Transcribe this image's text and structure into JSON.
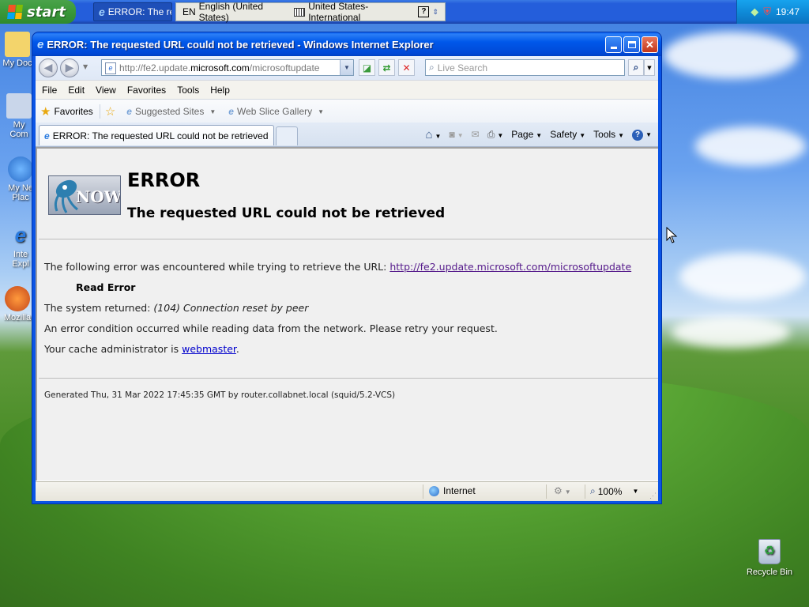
{
  "taskbar": {
    "start_label": "start",
    "task_ie_label": "ERROR: The re",
    "lang_code": "EN",
    "lang_name": "English (United States)",
    "keyboard_layout": "United States-International",
    "help_glyph": "?",
    "clock": "19:47"
  },
  "desktop": {
    "icons": [
      "My Doc",
      "My Com",
      "My Ne Plac",
      "Inte Expl",
      "Mozilla"
    ],
    "recycle_bin": "Recycle Bin"
  },
  "window": {
    "title": "ERROR: The requested URL could not be retrieved - Windows Internet Explorer",
    "address": {
      "prefix": "http://fe2.update.",
      "host": "microsoft.com",
      "path": "/microsoftupdate"
    },
    "search_placeholder": "Live Search",
    "menu": [
      "File",
      "Edit",
      "View",
      "Favorites",
      "Tools",
      "Help"
    ],
    "favorites_bar": {
      "favorites": "Favorites",
      "suggested": "Suggested Sites",
      "webslice": "Web Slice Gallery"
    },
    "tab_title": "ERROR: The requested URL could not be retrieved",
    "command_bar": {
      "page": "Page",
      "safety": "Safety",
      "tools": "Tools"
    },
    "status": {
      "zone": "Internet",
      "zoom": "100%"
    }
  },
  "page": {
    "logo_text": "NOW",
    "heading": "ERROR",
    "subheading": "The requested URL could not be retrieved",
    "line1_text": "The following error was encountered while trying to retrieve the URL: ",
    "line1_link": "http://fe2.update.microsoft.com/microsoftupdate",
    "error_name": "Read Error",
    "system_returned_label": "The system returned: ",
    "system_returned_value": "(104) Connection reset by peer",
    "condition_text": "An error condition occurred while reading data from the network. Please retry your request.",
    "admin_text": "Your cache administrator is ",
    "admin_link": "webmaster",
    "admin_suffix": ".",
    "footer": "Generated Thu, 31 Mar 2022 17:45:35 GMT by router.collabnet.local (squid/5.2-VCS)"
  },
  "colors": {
    "link": "#0000cc",
    "visited": "#551a8b",
    "titlebar": "#0058ea",
    "taskbar": "#245edb"
  }
}
